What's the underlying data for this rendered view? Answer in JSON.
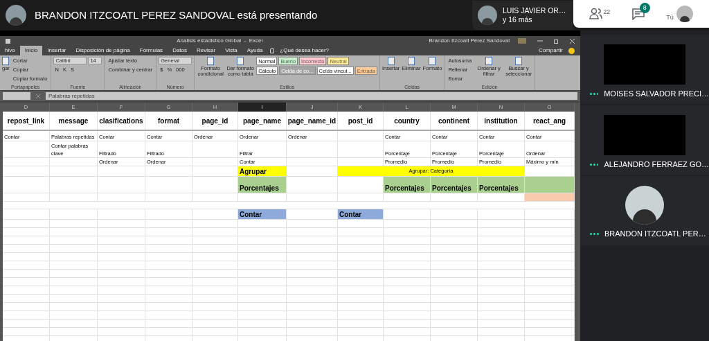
{
  "presenter_banner": {
    "text": "BRANDON ITZCOATL PEREZ SANDOVAL está presentando"
  },
  "participants_chip": {
    "name": "LUIS JAVIER OR…",
    "more": "y 16 más"
  },
  "toolbar": {
    "people_count": "22",
    "chat_count": "8",
    "self_label": "Tú"
  },
  "tiles": [
    {
      "name": "MOISES SALVADOR PRECI…",
      "kind": "camera_off"
    },
    {
      "name": "ALEJANDRO FERRAEZ GO…",
      "kind": "camera_off"
    },
    {
      "name": "BRANDON ITZCOATL PER…",
      "kind": "avatar"
    }
  ],
  "excel": {
    "title": "Analisis estadistico Global  -  Excel",
    "account": "Brandon Itzcoatl Pérez Sandoval",
    "tabs": [
      {
        "label": "hivo",
        "selected": false
      },
      {
        "label": "Inicio",
        "selected": true
      },
      {
        "label": "Insertar",
        "selected": false
      },
      {
        "label": "Disposición de página",
        "selected": false
      },
      {
        "label": "Fórmulas",
        "selected": false
      },
      {
        "label": "Datos",
        "selected": false
      },
      {
        "label": "Revisar",
        "selected": false
      },
      {
        "label": "Vista",
        "selected": false
      },
      {
        "label": "Ayuda",
        "selected": false
      }
    ],
    "search_hint": "¿Qué desea hacer?",
    "share": "Compartir",
    "groups": [
      {
        "name": "Portapapeles",
        "columns": [
          {
            "kind": "big",
            "label": "gar"
          },
          {
            "kind": "stack",
            "lines": [
              [
                {
                  "kind": "button",
                  "label": "Cortar"
                }
              ],
              [
                {
                  "kind": "button",
                  "label": "Copiar"
                }
              ],
              [
                {
                  "kind": "button",
                  "label": "Copiar formato"
                }
              ]
            ]
          }
        ]
      },
      {
        "name": "Fuente",
        "columns": [
          {
            "kind": "stack",
            "lines": [
              [
                {
                  "kind": "select",
                  "label": "Calibri"
                },
                {
                  "kind": "select",
                  "label": "14"
                }
              ],
              [
                {
                  "kind": "button",
                  "label": "N"
                },
                {
                  "kind": "button",
                  "label": "K"
                },
                {
                  "kind": "button",
                  "label": "S"
                }
              ]
            ]
          }
        ]
      },
      {
        "name": "Alineación",
        "columns": [
          {
            "kind": "stack",
            "lines": [
              [
                {
                  "kind": "button",
                  "label": "Ajustar texto"
                }
              ],
              [
                {
                  "kind": "button",
                  "label": "Combinar y centrar"
                }
              ]
            ]
          }
        ]
      },
      {
        "name": "Número",
        "columns": [
          {
            "kind": "stack",
            "lines": [
              [
                {
                  "kind": "select",
                  "label": "General"
                }
              ],
              [
                {
                  "kind": "button",
                  "label": "$"
                },
                {
                  "kind": "button",
                  "label": "%"
                },
                {
                  "kind": "button",
                  "label": "000"
                }
              ]
            ]
          }
        ]
      },
      {
        "name": "Estilos",
        "columns": [
          {
            "kind": "big",
            "label": "Formato condicional"
          },
          {
            "kind": "big",
            "label": "Dar formato como tabla"
          },
          {
            "kind": "stack",
            "lines": [
              [
                {
                  "kind": "swatch",
                  "label": "Normal",
                  "color": "#ffffff"
                },
                {
                  "kind": "swatch",
                  "label": "Bueno",
                  "color": "#c6efce"
                },
                {
                  "kind": "swatch",
                  "label": "Incorrecto",
                  "color": "#ffc7ce"
                },
                {
                  "kind": "swatch",
                  "label": "Neutral",
                  "color": "#ffeb9c"
                }
              ],
              [
                {
                  "kind": "swatch",
                  "label": "Cálculo",
                  "color": "#f2f2f2"
                },
                {
                  "kind": "swatch",
                  "label": "Celda de co...",
                  "color": "#a5a5a5"
                },
                {
                  "kind": "swatch",
                  "label": "Celda vincul...",
                  "color": "#ffffff"
                },
                {
                  "kind": "swatch",
                  "label": "Entrada",
                  "color": "#ffcc99"
                }
              ]
            ]
          }
        ]
      },
      {
        "name": "Celdas",
        "columns": [
          {
            "kind": "big",
            "label": "Insertar"
          },
          {
            "kind": "big",
            "label": "Eliminar"
          },
          {
            "kind": "big",
            "label": "Formato"
          }
        ]
      },
      {
        "name": "Edición",
        "columns": [
          {
            "kind": "stack",
            "lines": [
              [
                {
                  "kind": "button",
                  "label": "Autosuma"
                }
              ],
              [
                {
                  "kind": "button",
                  "label": "Rellenar"
                }
              ],
              [
                {
                  "kind": "button",
                  "label": "Borrar"
                }
              ]
            ]
          },
          {
            "kind": "big",
            "label": "Ordenar y filtrar"
          },
          {
            "kind": "big",
            "label": "Buscar y seleccionar"
          }
        ]
      }
    ],
    "formula": "Palabras repetidas",
    "columns": [
      {
        "letter": "D",
        "header": "repost_link",
        "selected": false
      },
      {
        "letter": "E",
        "header": "message",
        "selected": false
      },
      {
        "letter": "F",
        "header": "clasifications",
        "selected": false
      },
      {
        "letter": "G",
        "header": "format",
        "selected": false
      },
      {
        "letter": "H",
        "header": "page_id",
        "selected": false
      },
      {
        "letter": "I",
        "header": "page_name",
        "selected": true
      },
      {
        "letter": "J",
        "header": "page_name_id",
        "selected": false
      },
      {
        "letter": "K",
        "header": "post_id",
        "selected": false
      },
      {
        "letter": "L",
        "header": "country",
        "selected": false
      },
      {
        "letter": "M",
        "header": "continent",
        "selected": false
      },
      {
        "letter": "N",
        "header": "institution",
        "selected": false
      },
      {
        "letter": "O",
        "header": "react_ang",
        "selected": false
      }
    ],
    "rows": [
      {
        "kind": "normal",
        "cells": [
          {
            "kind": "plain",
            "text": "Contar"
          },
          {
            "kind": "plain",
            "text": "Palabras repetidas"
          },
          {
            "kind": "plain",
            "text": "Contar"
          },
          {
            "kind": "plain",
            "text": "Contar"
          },
          {
            "kind": "plain",
            "text": "Ordenar"
          },
          {
            "kind": "plain",
            "text": "Ordenar"
          },
          {
            "kind": "plain",
            "text": "Ordenar"
          },
          {
            "kind": "empty"
          },
          {
            "kind": "plain",
            "text": "Contar"
          },
          {
            "kind": "plain",
            "text": "Contar"
          },
          {
            "kind": "plain",
            "text": "Contar"
          },
          {
            "kind": "plain",
            "text": "Contar"
          }
        ]
      },
      {
        "kind": "tall",
        "cells": [
          {
            "kind": "empty"
          },
          {
            "kind": "plain",
            "text": "Contar palabras clave"
          },
          {
            "kind": "plain",
            "text": "Filtrado"
          },
          {
            "kind": "plain",
            "text": "Filtrado"
          },
          {
            "kind": "empty"
          },
          {
            "kind": "plain",
            "text": "Filtrar"
          },
          {
            "kind": "empty"
          },
          {
            "kind": "empty"
          },
          {
            "kind": "plain",
            "text": "Porcentaje"
          },
          {
            "kind": "plain",
            "text": "Porcentaje"
          },
          {
            "kind": "plain",
            "text": "Porcentaje"
          },
          {
            "kind": "plain",
            "text": "Ordenar"
          }
        ]
      },
      {
        "kind": "short",
        "cells": [
          {
            "kind": "empty"
          },
          {
            "kind": "empty"
          },
          {
            "kind": "plain",
            "text": "Ordenar"
          },
          {
            "kind": "plain",
            "text": "Ordenar"
          },
          {
            "kind": "empty"
          },
          {
            "kind": "plain",
            "text": "Contar"
          },
          {
            "kind": "empty"
          },
          {
            "kind": "empty"
          },
          {
            "kind": "plain",
            "text": "Promedio"
          },
          {
            "kind": "plain",
            "text": "Promedio"
          },
          {
            "kind": "plain",
            "text": "Promedio"
          },
          {
            "kind": "plain",
            "text": "Máximo y mín"
          }
        ]
      },
      {
        "kind": "normal",
        "cells": [
          {
            "kind": "empty"
          },
          {
            "kind": "empty"
          },
          {
            "kind": "empty"
          },
          {
            "kind": "empty"
          },
          {
            "kind": "empty"
          },
          {
            "kind": "strong",
            "text": "Agrupar",
            "color": "#ffff00"
          },
          {
            "kind": "empty"
          },
          {
            "kind": "merged",
            "text": "Agrupar: Categoría",
            "color": "#ffff00"
          },
          {
            "kind": "empty"
          }
        ]
      },
      {
        "kind": "tall",
        "cells": [
          {
            "kind": "empty"
          },
          {
            "kind": "empty"
          },
          {
            "kind": "empty"
          },
          {
            "kind": "empty"
          },
          {
            "kind": "empty"
          },
          {
            "kind": "strong",
            "text": "Porcentajes",
            "color": "#a9d08e"
          },
          {
            "kind": "empty"
          },
          {
            "kind": "empty"
          },
          {
            "kind": "strong",
            "text": "Porcentajes",
            "color": "#a9d08e"
          },
          {
            "kind": "strong",
            "text": "Porcentajes",
            "color": "#a9d08e"
          },
          {
            "kind": "strong",
            "text": "Porcentajes",
            "color": "#a9d08e"
          },
          {
            "kind": "empty",
            "color": "#a9d08e"
          }
        ]
      },
      {
        "kind": "short",
        "cells": [
          {
            "kind": "empty"
          },
          {
            "kind": "empty"
          },
          {
            "kind": "empty"
          },
          {
            "kind": "empty"
          },
          {
            "kind": "empty"
          },
          {
            "kind": "empty"
          },
          {
            "kind": "empty"
          },
          {
            "kind": "empty"
          },
          {
            "kind": "empty"
          },
          {
            "kind": "empty"
          },
          {
            "kind": "empty"
          },
          {
            "kind": "empty",
            "color": "#f8cbad"
          }
        ]
      },
      {
        "kind": "blank"
      },
      {
        "kind": "normal",
        "cells": [
          {
            "kind": "empty"
          },
          {
            "kind": "empty"
          },
          {
            "kind": "empty"
          },
          {
            "kind": "empty"
          },
          {
            "kind": "empty"
          },
          {
            "kind": "strong",
            "text": "Contar",
            "color": "#8eaadb"
          },
          {
            "kind": "empty"
          },
          {
            "kind": "strong",
            "text": "Contar",
            "color": "#8eaadb"
          },
          {
            "kind": "empty"
          },
          {
            "kind": "empty"
          },
          {
            "kind": "empty"
          },
          {
            "kind": "empty"
          }
        ]
      }
    ]
  }
}
